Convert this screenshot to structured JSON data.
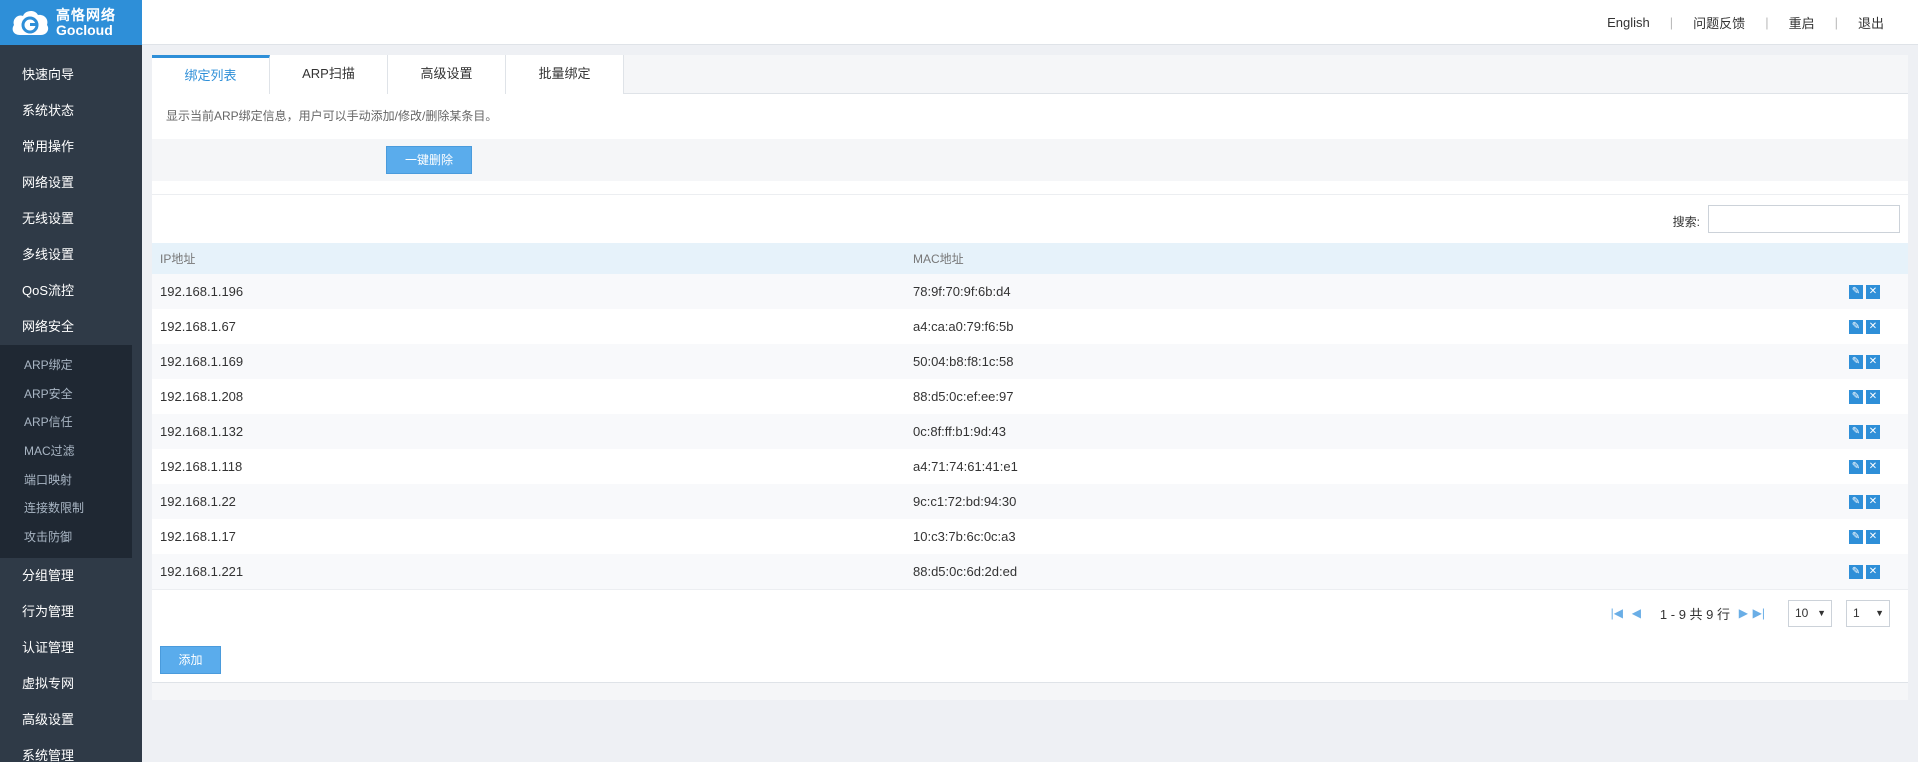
{
  "brand": {
    "name_cn": "高恪网络",
    "name_en": "Gocloud",
    "logo_color": "#2e8fd8"
  },
  "topnav": [
    {
      "label": "English"
    },
    {
      "label": "问题反馈"
    },
    {
      "label": "重启"
    },
    {
      "label": "退出"
    }
  ],
  "sidebar": {
    "items_top": [
      {
        "label": "快速向导"
      },
      {
        "label": "系统状态"
      },
      {
        "label": "常用操作"
      },
      {
        "label": "网络设置"
      },
      {
        "label": "无线设置"
      },
      {
        "label": "多线设置"
      },
      {
        "label": "QoS流控"
      },
      {
        "label": "网络安全"
      }
    ],
    "sub_items": [
      {
        "label": "ARP绑定"
      },
      {
        "label": "ARP安全"
      },
      {
        "label": "ARP信任"
      },
      {
        "label": "MAC过滤"
      },
      {
        "label": "端口映射"
      },
      {
        "label": "连接数限制"
      },
      {
        "label": "攻击防御"
      }
    ],
    "items_bottom": [
      {
        "label": "分组管理"
      },
      {
        "label": "行为管理"
      },
      {
        "label": "认证管理"
      },
      {
        "label": "虚拟专网"
      },
      {
        "label": "高级设置"
      },
      {
        "label": "系统管理"
      }
    ]
  },
  "tabs": [
    {
      "label": "绑定列表",
      "active": true
    },
    {
      "label": "ARP扫描"
    },
    {
      "label": "高级设置"
    },
    {
      "label": "批量绑定"
    }
  ],
  "description": "显示当前ARP绑定信息，用户可以手动添加/修改/删除某条目。",
  "toolbar": {
    "delete_all_label": "一键删除"
  },
  "search": {
    "label": "搜索:",
    "value": ""
  },
  "table": {
    "headers": {
      "ip": "IP地址",
      "mac": "MAC地址"
    },
    "rows": [
      {
        "ip": "192.168.1.196",
        "mac": "78:9f:70:9f:6b:d4"
      },
      {
        "ip": "192.168.1.67",
        "mac": "a4:ca:a0:79:f6:5b"
      },
      {
        "ip": "192.168.1.169",
        "mac": "50:04:b8:f8:1c:58"
      },
      {
        "ip": "192.168.1.208",
        "mac": "88:d5:0c:ef:ee:97"
      },
      {
        "ip": "192.168.1.132",
        "mac": "0c:8f:ff:b1:9d:43"
      },
      {
        "ip": "192.168.1.118",
        "mac": "a4:71:74:61:41:e1"
      },
      {
        "ip": "192.168.1.22",
        "mac": "9c:c1:72:bd:94:30"
      },
      {
        "ip": "192.168.1.17",
        "mac": "10:c3:7b:6c:0c:a3"
      },
      {
        "ip": "192.168.1.221",
        "mac": "88:d5:0c:6d:2d:ed"
      }
    ]
  },
  "pager": {
    "info": "1 - 9 共 9 行",
    "page_size": "10",
    "page": "1"
  },
  "add_label": "添加"
}
